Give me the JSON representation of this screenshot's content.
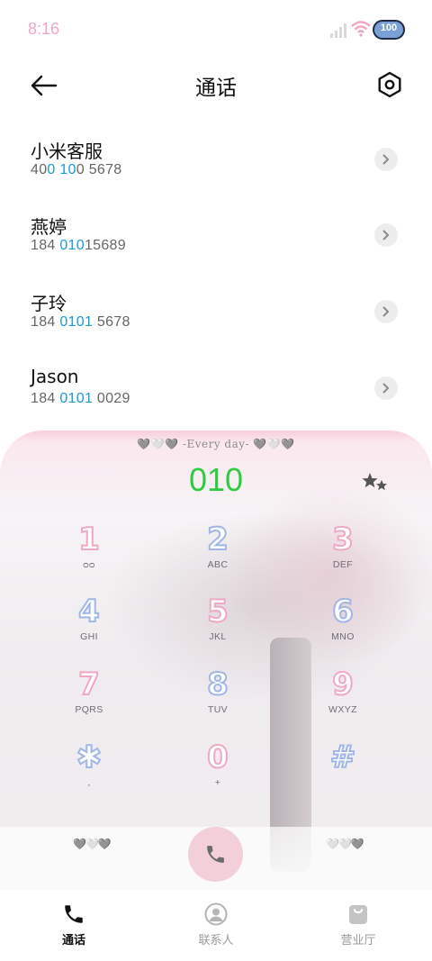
{
  "status_bar": {
    "time": "8:16",
    "battery": "100"
  },
  "header": {
    "title": "通话",
    "back_icon": "arrow-left-icon",
    "settings_icon": "settings-icon"
  },
  "contacts": [
    {
      "name": "小米客服",
      "num_parts": [
        "40",
        "0 10",
        "0 5678"
      ]
    },
    {
      "name": "燕婷",
      "num_parts": [
        "184 ",
        "010",
        "15689"
      ]
    },
    {
      "name": "子玲",
      "num_parts": [
        "184 ",
        "0101",
        " 5678"
      ]
    },
    {
      "name": "Jason",
      "num_parts": [
        "184 ",
        "0101",
        " 0029"
      ]
    }
  ],
  "dialer": {
    "banner": "🩶🤍🩶 -Every day- 🩶🤍🩶",
    "input_value": "010",
    "keys": [
      {
        "digit": "1",
        "letters": "ᴑᴑ"
      },
      {
        "digit": "2",
        "letters": "ABC"
      },
      {
        "digit": "3",
        "letters": "DEF"
      },
      {
        "digit": "4",
        "letters": "GHI"
      },
      {
        "digit": "5",
        "letters": "JKL"
      },
      {
        "digit": "6",
        "letters": "MNO"
      },
      {
        "digit": "7",
        "letters": "PQRS"
      },
      {
        "digit": "8",
        "letters": "TUV"
      },
      {
        "digit": "9",
        "letters": "WXYZ"
      },
      {
        "digit": "✱",
        "letters": ","
      },
      {
        "digit": "0",
        "letters": "+"
      },
      {
        "digit": "#",
        "letters": ""
      }
    ],
    "hearts_left": "🩶🤍🩶",
    "hearts_right": "🤍🤍🩶"
  },
  "colors": {
    "accent_blue": "#1a9ad6",
    "digits_green": "#2ecc40",
    "pink": "#f0a9c4",
    "light_blue": "#9fb6e6"
  },
  "bottom_nav": [
    {
      "label": "通话",
      "icon": "phone-icon",
      "active": true
    },
    {
      "label": "联系人",
      "icon": "person-icon",
      "active": false
    },
    {
      "label": "营业厅",
      "icon": "shopping-bag-icon",
      "active": false
    }
  ]
}
